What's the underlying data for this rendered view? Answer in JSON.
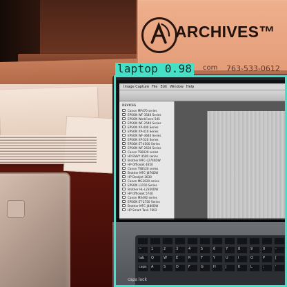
{
  "scene": {
    "sign": {
      "brand": "ARCHIVES",
      "trademark": "™",
      "phone": "763-533-0612",
      "web_suffix": "com"
    },
    "detection": {
      "label": "laptop 0.98",
      "color": "#45e0c5"
    },
    "laptop_screen": {
      "menubar": [
        "Image Capture",
        "File",
        "Edit",
        "Window",
        "Help"
      ],
      "sidebar_header": "DEVICES",
      "sidebar_items": [
        "Canon MP470 series",
        "EPSON WF-3540 Series",
        "EPSON WorkForce 545",
        "EPSON WF-2540 Series",
        "EPSON XP-400 Series",
        "EPSON XP-410 Series",
        "EPSON WF-3640 Series",
        "EPSON XP-520 Series",
        "EPSON ET-4500 Series",
        "EPSON WF-2630 Series",
        "Canon TS6020 series",
        "HP ENVY 4500 series",
        "Brother MFC-L2740DW",
        "HP OfficeJet 4650",
        "Canon TS8120 series",
        "Brother MFC-J870DW",
        "HP DeskJet 3630",
        "Canon MG3620 series",
        "EPSON L3150 Series",
        "Brother HL-L2350DW",
        "HP OfficeJet 5740",
        "Canon MX492 series",
        "EPSON ET-2750 Series",
        "Brother MFC-J480DW",
        "HP Smart Tank 7602"
      ]
    },
    "keyboard": {
      "rows": [
        [
          "",
          "",
          "",
          "",
          "",
          "",
          "",
          "",
          "",
          "",
          "",
          ""
        ],
        [
          "~",
          "1",
          "2",
          "3",
          "4",
          "5",
          "6",
          "7",
          "8",
          "9",
          "0",
          "-"
        ],
        [
          "tab",
          "Q",
          "W",
          "E",
          "R",
          "T",
          "Y",
          "U",
          "I",
          "O",
          "P",
          "["
        ],
        [
          "caps",
          "A",
          "S",
          "D",
          "F",
          "G",
          "H",
          "J",
          "K",
          "L",
          ";",
          "'"
        ]
      ],
      "bottom_left_label": "caps lock"
    }
  }
}
